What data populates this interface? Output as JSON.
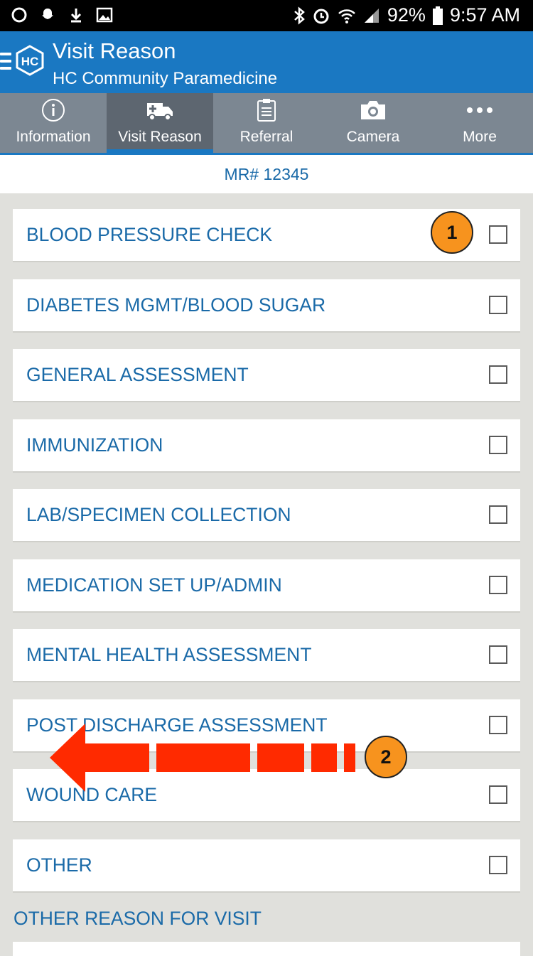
{
  "status_bar": {
    "battery": "92%",
    "time": "9:57 AM",
    "left_icons": [
      "circle-icon",
      "snapchat-icon",
      "download-icon",
      "image-icon"
    ],
    "right_icons": [
      "bluetooth-icon",
      "alarm-icon",
      "wifi-icon",
      "signal-icon",
      "battery-icon"
    ]
  },
  "app_bar": {
    "logo_text": "HC",
    "title": "Visit Reason",
    "subtitle": "HC Community Paramedicine"
  },
  "tabs": [
    {
      "label": "Information",
      "icon": "info-icon",
      "active": false
    },
    {
      "label": "Visit Reason",
      "icon": "ambulance-icon",
      "active": true
    },
    {
      "label": "Referral",
      "icon": "clipboard-icon",
      "active": false
    },
    {
      "label": "Camera",
      "icon": "camera-icon",
      "active": false
    },
    {
      "label": "More",
      "icon": "more-icon",
      "active": false
    }
  ],
  "mr_header": "MR# 12345",
  "visit_reasons": [
    {
      "label": "BLOOD PRESSURE CHECK",
      "checked": false
    },
    {
      "label": "DIABETES MGMT/BLOOD SUGAR",
      "checked": false
    },
    {
      "label": "GENERAL ASSESSMENT",
      "checked": false
    },
    {
      "label": "IMMUNIZATION",
      "checked": false
    },
    {
      "label": "LAB/SPECIMEN COLLECTION",
      "checked": false
    },
    {
      "label": "MEDICATION SET UP/ADMIN",
      "checked": false
    },
    {
      "label": "MENTAL HEALTH ASSESSMENT",
      "checked": false
    },
    {
      "label": "POST DISCHARGE ASSESSMENT",
      "checked": false
    },
    {
      "label": "WOUND CARE",
      "checked": false
    },
    {
      "label": "OTHER",
      "checked": false
    }
  ],
  "other_reason_label": "OTHER REASON FOR VISIT",
  "annotations": {
    "badge_1": "1",
    "badge_2": "2",
    "arrow_color": "#ff2a00",
    "badge_color": "#f7931e"
  },
  "colors": {
    "app_bar": "#1a78c2",
    "tab_bar": "#7c8792",
    "tab_active": "#5d6670",
    "text_blue": "#1a6aa8",
    "background": "#e0e0dc"
  }
}
